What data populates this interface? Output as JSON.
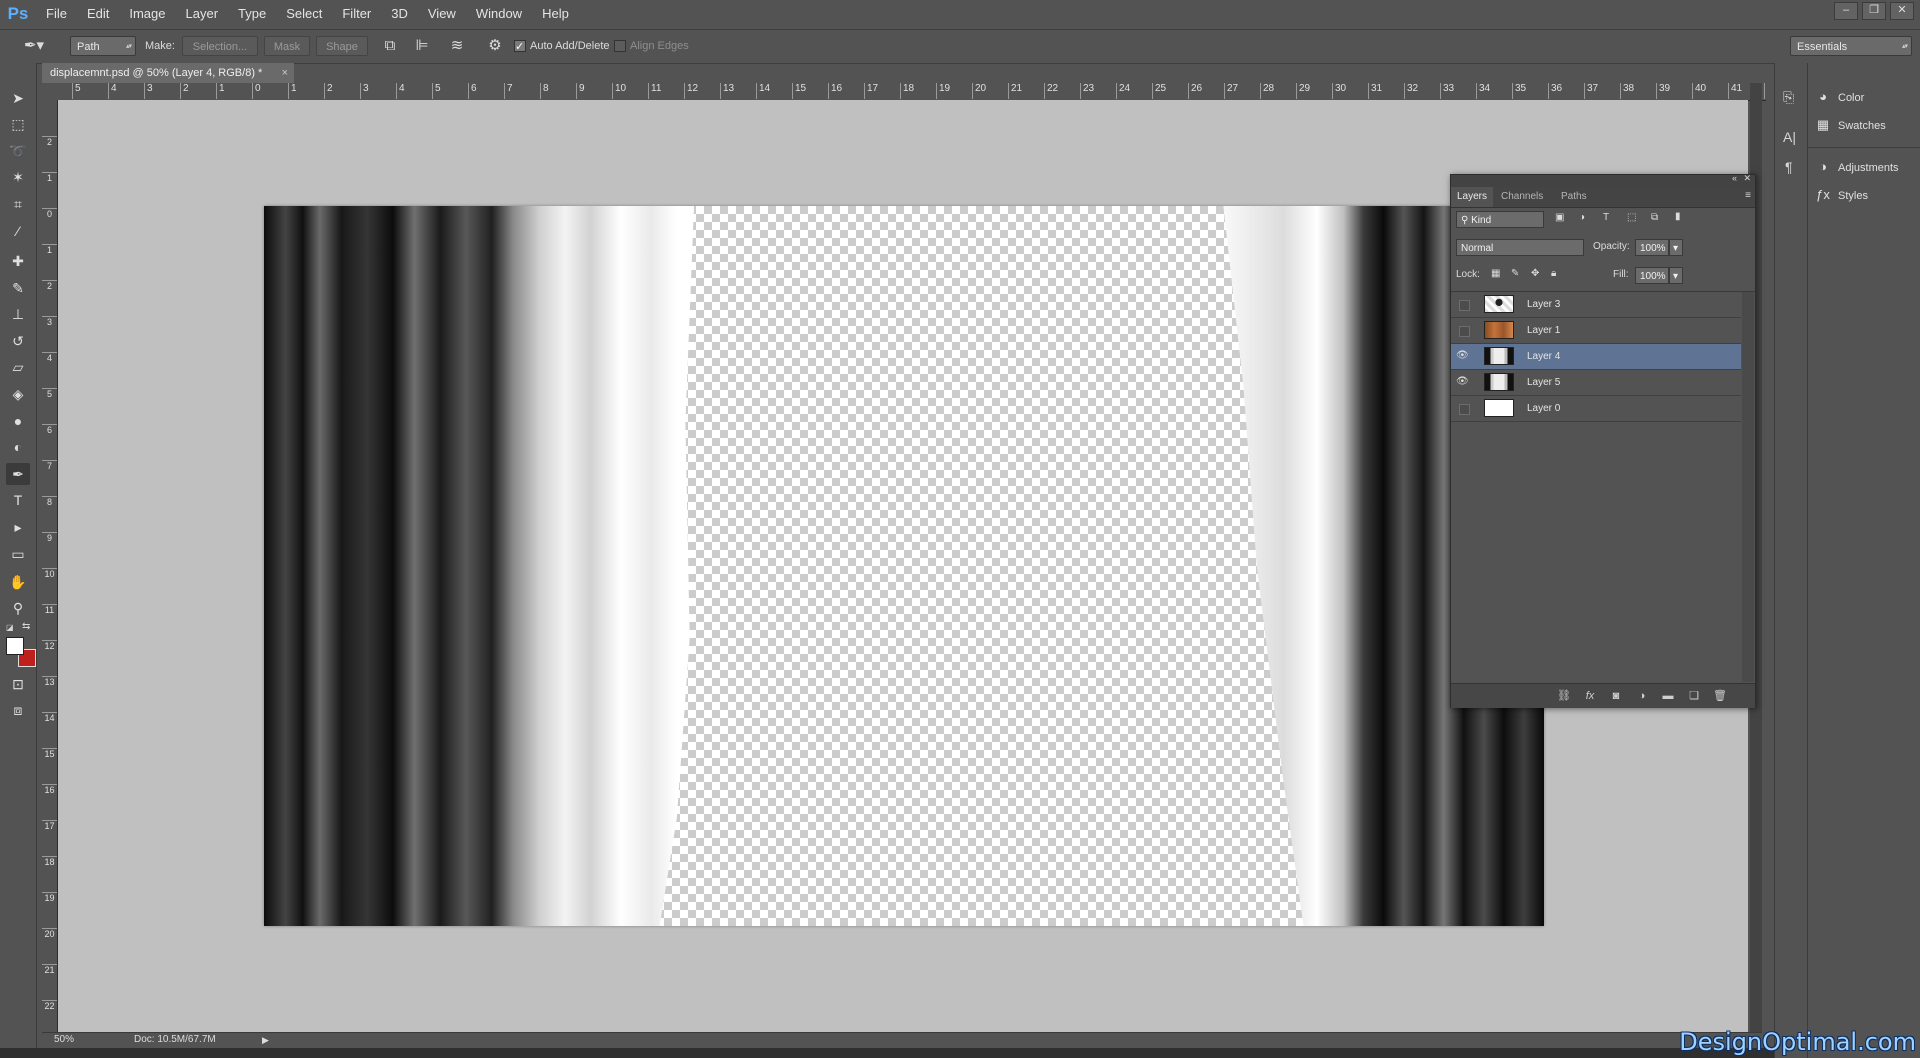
{
  "app": {
    "logo": "Ps"
  },
  "menu": [
    "File",
    "Edit",
    "Image",
    "Layer",
    "Type",
    "Select",
    "Filter",
    "3D",
    "View",
    "Window",
    "Help"
  ],
  "window_controls": [
    "–",
    "❐",
    "✕"
  ],
  "options_bar": {
    "tool_mode": "Path",
    "make_label": "Make:",
    "selection_button": "Selection...",
    "mask_button": "Mask",
    "shape_button": "Shape",
    "auto_add_delete": "Auto Add/Delete",
    "align_edges": "Align Edges",
    "workspace": "Essentials"
  },
  "document": {
    "tab_title": "displacemnt.psd @ 50% (Layer 4, RGB/8) *",
    "close": "×",
    "ruler_top": [
      "5",
      "4",
      "3",
      "2",
      "1",
      "0",
      "1",
      "2",
      "3",
      "4",
      "5",
      "6",
      "7",
      "8",
      "9",
      "10",
      "11",
      "12",
      "13",
      "14",
      "15",
      "16",
      "17",
      "18",
      "19",
      "20",
      "21",
      "22",
      "23",
      "24",
      "25",
      "26",
      "27",
      "28",
      "29",
      "30",
      "31",
      "32",
      "33",
      "34",
      "35",
      "36",
      "37",
      "38",
      "39",
      "40",
      "41",
      "4"
    ],
    "ruler_left": [
      "2",
      "1",
      "0",
      "1",
      "2",
      "3",
      "4",
      "5",
      "6",
      "7",
      "8",
      "9",
      "10",
      "11",
      "12",
      "13",
      "14",
      "15",
      "16",
      "17",
      "18",
      "19",
      "20",
      "21",
      "22"
    ]
  },
  "status": {
    "zoom": "50%",
    "doc_size": "Doc: 10.5M/67.7M"
  },
  "dock": {
    "items": [
      {
        "label": "Color",
        "icon": "palette-icon"
      },
      {
        "label": "Swatches",
        "icon": "grid-icon"
      },
      {
        "label": "Adjustments",
        "icon": "adjustment-icon"
      },
      {
        "label": "Styles",
        "icon": "fx-icon"
      }
    ]
  },
  "layers_panel": {
    "tabs": [
      "Layers",
      "Channels",
      "Paths"
    ],
    "filter_kind": "Kind",
    "blend_mode": "Normal",
    "opacity_label": "Opacity:",
    "opacity_value": "100%",
    "lock_label": "Lock:",
    "fill_label": "Fill:",
    "fill_value": "100%",
    "layers": [
      {
        "name": "Layer 3",
        "visible": false,
        "selected": false,
        "thumb": "figure"
      },
      {
        "name": "Layer 1",
        "visible": false,
        "selected": false,
        "thumb": "wood"
      },
      {
        "name": "Layer 4",
        "visible": true,
        "selected": true,
        "thumb": "curtain"
      },
      {
        "name": "Layer 5",
        "visible": true,
        "selected": false,
        "thumb": "curtain"
      },
      {
        "name": "Layer 0",
        "visible": false,
        "selected": false,
        "thumb": "white"
      }
    ],
    "footer_icons": [
      "link-icon",
      "fx-icon",
      "mask-icon",
      "adjustment-icon",
      "folder-icon",
      "new-layer-icon",
      "trash-icon"
    ]
  },
  "colors": {
    "foreground": "#ffffff",
    "background": "#c0201b",
    "selection": "#5f7394"
  },
  "watermark": "DesignOptimal.com"
}
